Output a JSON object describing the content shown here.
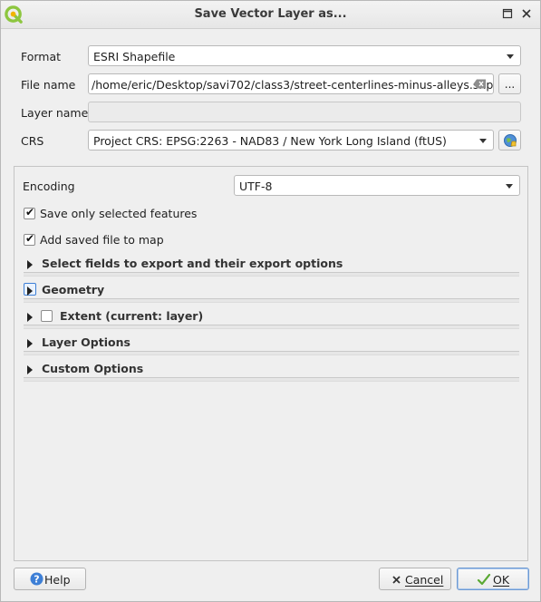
{
  "window": {
    "title": "Save Vector Layer as...",
    "app_icon": "qgis-logo-icon",
    "buttons": {
      "restore_icon": "restore-icon",
      "close_icon": "close-icon"
    }
  },
  "form": {
    "format": {
      "label": "Format",
      "value": "ESRI Shapefile"
    },
    "file_name": {
      "label": "File name",
      "value": "/home/eric/Desktop/savi702/class3/street-centerlines-minus-alleys.shp",
      "browse_label": "..."
    },
    "layer_name": {
      "label": "Layer name",
      "value": ""
    },
    "crs": {
      "label": "CRS",
      "value": "Project CRS: EPSG:2263 - NAD83 / New York Long Island (ftUS)"
    }
  },
  "options": {
    "encoding": {
      "label": "Encoding",
      "value": "UTF-8"
    },
    "save_selected": {
      "label": "Save only selected features",
      "checked": true
    },
    "add_to_map": {
      "label": "Add saved file to map",
      "checked": true
    },
    "sections": [
      {
        "title": "Select fields to export and their export options",
        "has_checkbox": false
      },
      {
        "title": "Geometry",
        "has_checkbox": false,
        "focused": true
      },
      {
        "title": "Extent (current: layer)",
        "has_checkbox": true,
        "checked": false
      },
      {
        "title": "Layer Options",
        "has_checkbox": false
      },
      {
        "title": "Custom Options",
        "has_checkbox": false
      }
    ]
  },
  "footer": {
    "help_label": "Help",
    "cancel_label": "Cancel",
    "ok_label": "OK"
  },
  "colors": {
    "accent": "#3d7fd6",
    "qgis_green": "#8dc63f"
  }
}
